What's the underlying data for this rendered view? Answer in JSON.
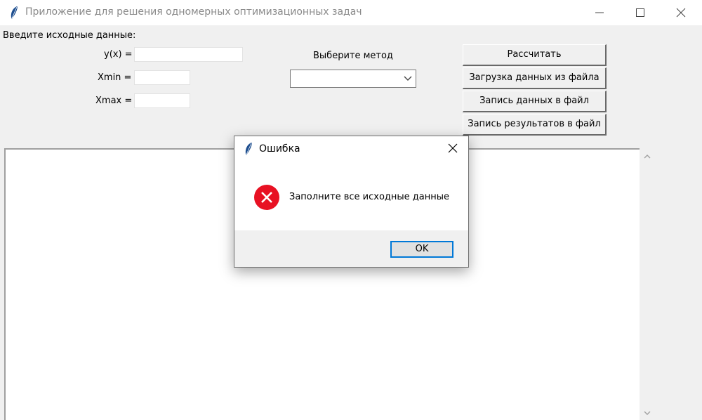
{
  "window": {
    "title": "Приложение для решения одномерных оптимизационных задач",
    "icon": "feather-icon",
    "controls": [
      "minimize-icon",
      "maximize-icon",
      "close-icon"
    ]
  },
  "inputs": {
    "section_label": "Введите исходные данные:",
    "y_label": "y(x) =",
    "y_value": "",
    "xmin_label": "Xmin =",
    "xmin_value": "",
    "xmax_label": "Xmax =",
    "xmax_value": ""
  },
  "method": {
    "label": "Выберите метод",
    "selected": ""
  },
  "buttons": {
    "calculate": "Рассчитать",
    "load": "Загрузка данных из файла",
    "save_data": "Запись данных в файл",
    "save_results": "Запись результатов в файл"
  },
  "output": {
    "text": ""
  },
  "dialog": {
    "title": "Ошибка",
    "message": "Заполните все исходные данные",
    "ok_label": "OK",
    "icon": "error-icon",
    "colors": {
      "error_red": "#e81123",
      "ok_border": "#0078d7"
    }
  }
}
